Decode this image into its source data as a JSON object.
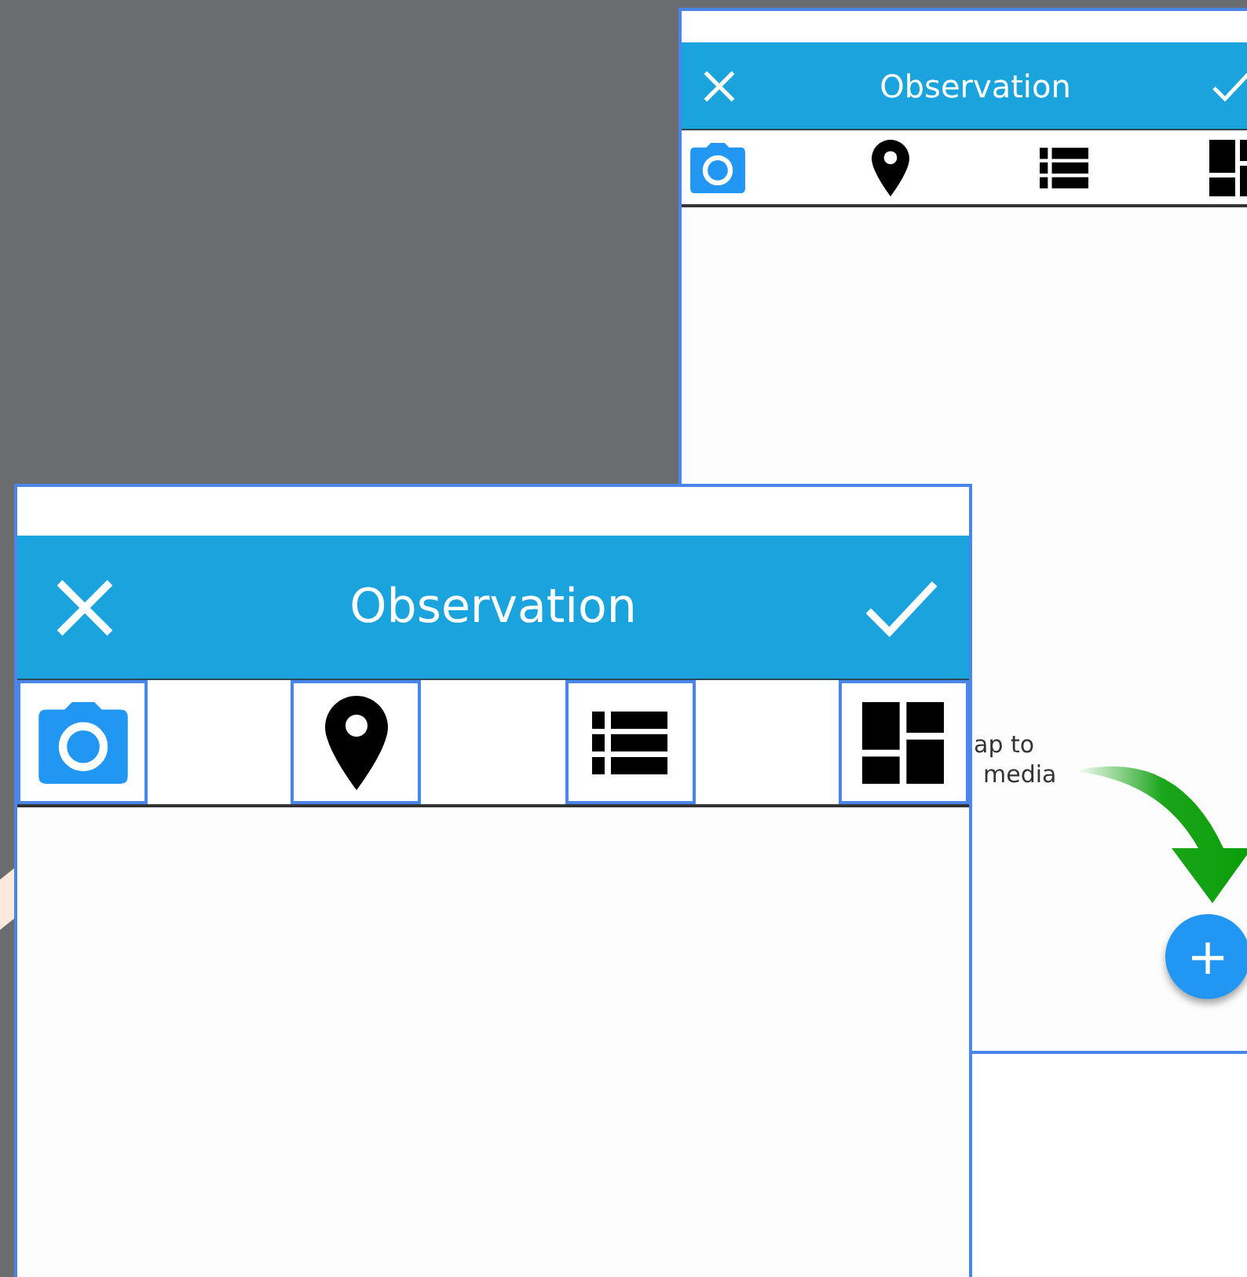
{
  "windows": [
    {
      "title": "Observation",
      "tabs": [
        {
          "kind": "camera",
          "selected": true
        },
        {
          "kind": "pin",
          "selected": false
        },
        {
          "kind": "list",
          "selected": false
        },
        {
          "kind": "dashboard",
          "selected": false
        }
      ],
      "hint_lines": [
        "ap to",
        "media"
      ],
      "fab": {
        "label": "+"
      }
    },
    {
      "title": "Observation",
      "tabs": [
        {
          "kind": "camera",
          "selected": true
        },
        {
          "kind": "pin",
          "selected": false
        },
        {
          "kind": "list",
          "selected": false
        },
        {
          "kind": "dashboard",
          "selected": false
        }
      ]
    }
  ]
}
